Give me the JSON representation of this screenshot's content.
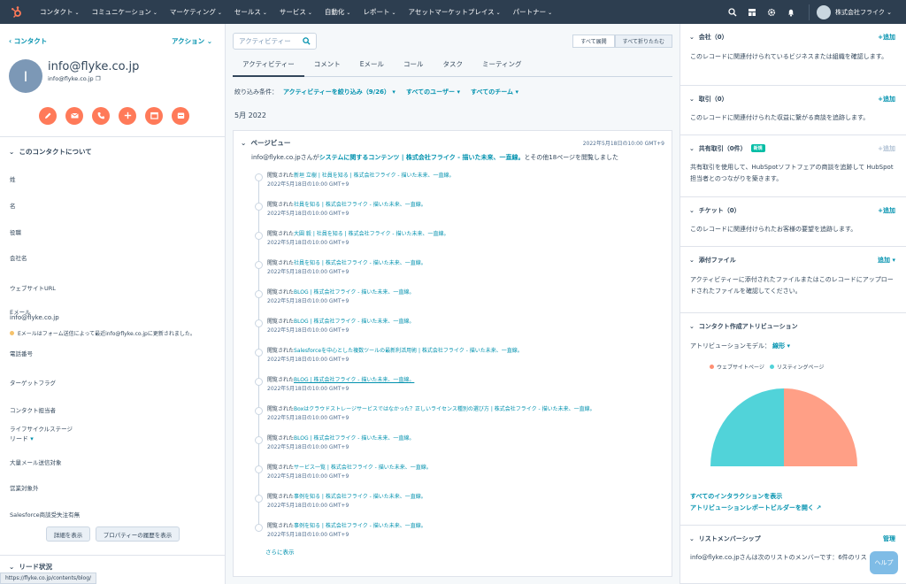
{
  "nav": {
    "items": [
      "コンタクト",
      "コミュニケーション",
      "マーケティング",
      "セールス",
      "サービス",
      "自動化",
      "レポート",
      "アセットマーケットプレイス",
      "パートナー"
    ],
    "account": "株式会社フライク"
  },
  "contact": {
    "back": "コンタクト",
    "actions": "アクション",
    "initial": "I",
    "name": "info@flyke.co.jp",
    "email": "info@flyke.co.jp",
    "action_icons": [
      "note-icon",
      "email-icon",
      "phone-icon",
      "add-icon",
      "meeting-icon",
      "calendar-icon"
    ]
  },
  "about": {
    "title": "このコンタクトについて",
    "props": {
      "last_name": "姓",
      "first_name": "名",
      "job": "役職",
      "company": "会社名",
      "website": "ウェブサイトURL",
      "email_label": "Eメール",
      "email_value": "info@flyke.co.jp",
      "warning": "Eメールはフォーム送信によって最近info@flyke.co.jpに更新されました。",
      "phone": "電話番号",
      "target": "ターゲットフラグ",
      "owner": "コンタクト担当者",
      "lifecycle": "ライフサイクルステージ",
      "lifecycle_value": "リード",
      "bulk": "大量メール送信対象",
      "sales": "営業対象外",
      "sfdc": "Salesforce商談受失注有無"
    },
    "btn_details": "詳細を表示",
    "btn_history": "プロパティーの履歴を表示"
  },
  "lead_section": "リード状況",
  "status_url": "https://flyke.co.jp/contents/blog/",
  "activity": {
    "search_placeholder": "アクティビティー",
    "expand_all": "すべて展開",
    "collapse_all": "すべて折りたたむ",
    "tabs": [
      "アクティビティー",
      "コメント",
      "Eメール",
      "コール",
      "タスク",
      "ミーティング"
    ],
    "filter_label": "絞り込み条件：",
    "filter_activity": "アクティビティーを絞り込み（9/26）",
    "filter_users": "すべてのユーザー",
    "filter_teams": "すべてのチーム",
    "month": "5月 2022",
    "card_title": "ページビュー",
    "card_date": "2022年5月18日の10:00 GMT+9",
    "summary_pre": "info@flyke.co.jpさんが",
    "summary_link": "システムに関するコンテンツ | 株式会社フライク - 描いた未来、一直線。",
    "summary_post": "とその他18ページを閲覧しました",
    "viewed_prefix": "閲覧された",
    "pages": [
      "新垣 立樹 | 社員を知る | 株式会社フライク - 描いた未来、一直線。",
      "社員を知る | 株式会社フライク - 描いた未来、一直線。",
      "大圓 毅 | 社員を知る | 株式会社フライク - 描いた未来、一直線。",
      "社員を知る | 株式会社フライク - 描いた未来、一直線。",
      "BLOG | 株式会社フライク - 描いた未来、一直線。",
      "BLOG | 株式会社フライク - 描いた未来、一直線。",
      "Salesforceを中心とした複数ツールの最新利活用術 | 株式会社フライク - 描いた未来、一直線。",
      "BLOG | 株式会社フライク - 描いた未来、一直線。",
      "Boxはクラウドストレージサービスではなかった？正しいライセンス種別の選び方 | 株式会社フライク - 描いた未来、一直線。",
      "BLOG | 株式会社フライク - 描いた未来、一直線。",
      "サービス一覧 | 株式会社フライク - 描いた未来、一直線。",
      "事例を知る | 株式会社フライク - 描いた未来、一直線。",
      "事例を知る | 株式会社フライク - 描いた未来、一直線。"
    ],
    "item_date": "2022年5月18日の10:00 GMT+9",
    "show_more": "さらに表示"
  },
  "right": {
    "company": {
      "title": "会社（0）",
      "add": "+追加",
      "desc": "このレコードに関連付けられているビジネスまたは組織を確認します。"
    },
    "deals": {
      "title": "取引（0）",
      "add": "+追加",
      "desc": "このレコードに関連付けられた収益に繋がる商談を追跡します。"
    },
    "shared_deals": {
      "title": "共有取引（0件）",
      "badge": "新規",
      "add": "+追加",
      "desc": "共有取引を使用して、HubSpotソフトフェアの商談を追跡して HubSpot担当者とのつながりを築きます。"
    },
    "tickets": {
      "title": "チケット（0）",
      "add": "+追加",
      "desc": "このレコードに関連付けられたお客様の要望を追跡します。"
    },
    "files": {
      "title": "添付ファイル",
      "add": "追加",
      "desc": "アクティビティーに添付されたファイルまたはこのレコードにアップロードされたファイルを確認してください。"
    },
    "attribution": {
      "title": "コンタクト作成アトリビューション",
      "model_label": "アトリビューションモデル：",
      "model_value": "線形",
      "legend": [
        {
          "label": "ウェブサイトページ",
          "color": "#ff8f73"
        },
        {
          "label": "リスティングページ",
          "color": "#51d3d9"
        }
      ],
      "link1": "すべてのインタラクションを表示",
      "link2": "アトリビューションレポートビルダーを開く"
    },
    "lists": {
      "title": "リストメンバーシップ",
      "manage": "管理",
      "desc": "info@flyke.co.jpさんは次のリストのメンバーです：6件のリス"
    }
  },
  "help": "ヘルプ"
}
